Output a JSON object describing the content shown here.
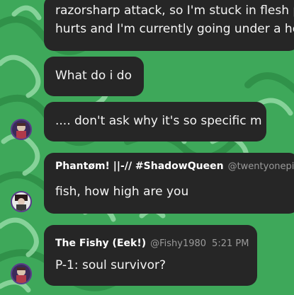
{
  "messages": [
    {
      "lines": [
        "razorsharp attack, so I'm stuck in flesh p",
        "hurts and I'm currently going under a he"
      ]
    },
    {
      "lines": [
        "What do i do"
      ]
    },
    {
      "lines": [
        ".... don't ask why it's so specific m"
      ]
    },
    {
      "author": "Phantøm! ||-// #ShadowQueen",
      "handle": "@twentyonepilo",
      "lines": [
        "fish, how high are you"
      ]
    },
    {
      "author": "The Fishy (Eek!)",
      "handle": "@Fishy1980",
      "time": "5:21 PM",
      "lines": [
        "P-1: soul survivor?"
      ]
    }
  ],
  "avatars": [
    {
      "name": "avatar-fishy"
    },
    {
      "name": "avatar-phantom"
    },
    {
      "name": "avatar-fishy"
    }
  ],
  "colors": {
    "bubble": "#262626",
    "background_green": "#3ea85a",
    "pattern_light": "#8fd6a0",
    "text": "#f4f4f4",
    "meta": "#9a9a9a"
  }
}
